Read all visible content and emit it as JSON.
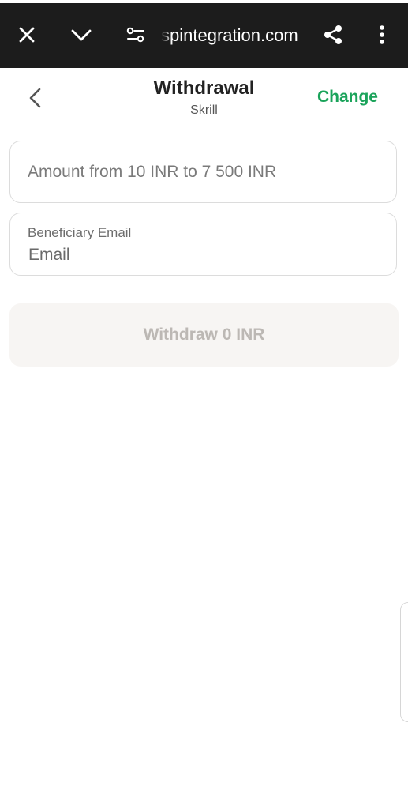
{
  "browser": {
    "url": "spintegration.com",
    "icons": {
      "close": "close-icon",
      "collapse": "chevron-down-icon",
      "site_settings": "tune-icon",
      "share": "share-icon",
      "menu": "more-vert-icon"
    }
  },
  "header": {
    "title": "Withdrawal",
    "subtitle": "Skrill",
    "change_label": "Change"
  },
  "form": {
    "amount": {
      "placeholder": "Amount from 10 INR to 7 500 INR",
      "value": ""
    },
    "email": {
      "label": "Beneficiary Email",
      "placeholder": "Email",
      "value": ""
    },
    "submit_label": "Withdraw 0 INR"
  },
  "colors": {
    "accent": "#1aa35a",
    "browser_bar": "#1c1c1c",
    "button_disabled_bg": "#f7f5f3",
    "button_disabled_text": "#bcb8b4"
  }
}
